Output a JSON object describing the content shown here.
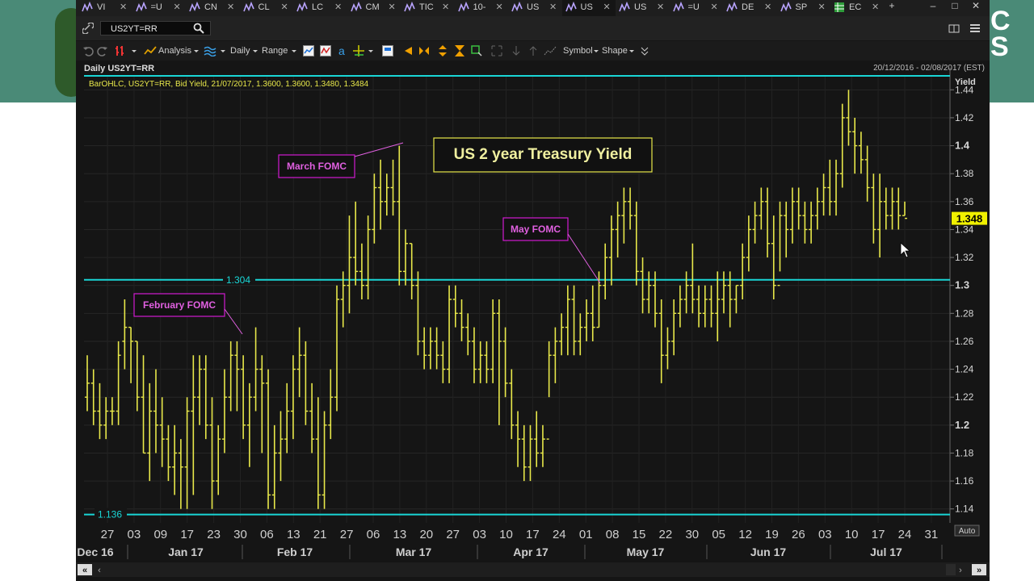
{
  "tabs": [
    {
      "label": "VI",
      "active": false
    },
    {
      "label": "=U",
      "active": false
    },
    {
      "label": "CN",
      "active": false
    },
    {
      "label": "CL",
      "active": false
    },
    {
      "label": "LC",
      "active": false
    },
    {
      "label": "CM",
      "active": false
    },
    {
      "label": "TIC",
      "active": false
    },
    {
      "label": "10-",
      "active": false
    },
    {
      "label": "US",
      "active": false
    },
    {
      "label": "US",
      "active": true
    },
    {
      "label": "US",
      "active": false
    },
    {
      "label": "=U",
      "active": false
    },
    {
      "label": "DE",
      "active": false
    },
    {
      "label": "SP",
      "active": false
    },
    {
      "label": "EC",
      "active": false
    }
  ],
  "window_controls": {
    "add": "+",
    "minimize": "–",
    "maximize": "□",
    "close": "✕"
  },
  "address": {
    "ric": "US2YT=RR"
  },
  "toolbar": {
    "analysis": "Analysis",
    "interval": "Daily",
    "range": "Range",
    "symbol": "Symbol",
    "shape": "Shape"
  },
  "background": {
    "side_text": "C\nS"
  },
  "colors": {
    "bars": "#e8e84a",
    "hline": "#19d6d6",
    "annotation_border": "#d01ad0",
    "annotation_text": "#e060e0",
    "title_border": "#e8e84a",
    "last_badge": "#f0f000"
  },
  "chart_data": {
    "type": "ohlc",
    "header": "Daily US2YT=RR",
    "date_range": "20/12/2016 - 02/08/2017 (EST)",
    "info_line": "BarOHLC, US2YT=RR, Bid Yield, 21/07/2017, 1.3600, 1.3600, 1.3480, 1.3484",
    "title": "US 2 year Treasury Yield",
    "y_axis_label": "Yield",
    "auto_label": "Auto",
    "ylim": [
      1.13,
      1.45
    ],
    "y_ticks": [
      1.14,
      1.16,
      1.18,
      1.2,
      1.22,
      1.24,
      1.26,
      1.28,
      1.3,
      1.32,
      1.34,
      1.36,
      1.38,
      1.4,
      1.42,
      1.44
    ],
    "y_tick_labels": [
      "1.14",
      "1.16",
      "1.18",
      "1.2",
      "1.22",
      "1.24",
      "1.26",
      "1.28",
      "1.3",
      "1.32",
      "1.34",
      "1.36",
      "1.38",
      "1.4",
      "1.42",
      "1.44"
    ],
    "last_value": "1.348",
    "day_labels": [
      "27",
      "03",
      "09",
      "17",
      "23",
      "30",
      "06",
      "13",
      "21",
      "27",
      "06",
      "13",
      "20",
      "27",
      "03",
      "10",
      "17",
      "24",
      "01",
      "08",
      "15",
      "22",
      "30",
      "05",
      "12",
      "19",
      "26",
      "03",
      "10",
      "17",
      "24",
      "31"
    ],
    "month_labels": [
      "Dec 16",
      "Jan 17",
      "Feb 17",
      "Mar 17",
      "Apr 17",
      "May 17",
      "Jun 17",
      "Jul 17"
    ],
    "horizontal_lines": [
      {
        "value": 1.304,
        "label": "1.304"
      },
      {
        "value": 1.136,
        "label": "1.136"
      },
      {
        "value": 1.45,
        "label": ""
      }
    ],
    "annotations": [
      "February FOMC",
      "March FOMC",
      "May FOMC"
    ],
    "bars": [
      [
        1.22,
        1.25,
        1.21,
        1.23
      ],
      [
        1.23,
        1.24,
        1.2,
        1.21
      ],
      [
        1.21,
        1.23,
        1.19,
        1.2
      ],
      [
        1.2,
        1.22,
        1.19,
        1.21
      ],
      [
        1.21,
        1.22,
        1.2,
        1.21
      ],
      [
        1.21,
        1.26,
        1.2,
        1.25
      ],
      [
        1.26,
        1.29,
        1.24,
        1.27
      ],
      [
        1.27,
        1.27,
        1.23,
        1.26
      ],
      [
        1.26,
        1.26,
        1.21,
        1.22
      ],
      [
        1.22,
        1.25,
        1.18,
        1.18
      ],
      [
        1.18,
        1.23,
        1.16,
        1.21
      ],
      [
        1.21,
        1.24,
        1.18,
        1.2
      ],
      [
        1.2,
        1.22,
        1.17,
        1.19
      ],
      [
        1.19,
        1.2,
        1.16,
        1.17
      ],
      [
        1.17,
        1.2,
        1.15,
        1.18
      ],
      [
        1.18,
        1.19,
        1.14,
        1.17
      ],
      [
        1.17,
        1.22,
        1.14,
        1.21
      ],
      [
        1.21,
        1.25,
        1.15,
        1.22
      ],
      [
        1.22,
        1.25,
        1.2,
        1.24
      ],
      [
        1.24,
        1.25,
        1.19,
        1.2
      ],
      [
        1.2,
        1.22,
        1.14,
        1.16
      ],
      [
        1.16,
        1.2,
        1.15,
        1.19
      ],
      [
        1.19,
        1.24,
        1.18,
        1.22
      ],
      [
        1.22,
        1.26,
        1.21,
        1.25
      ],
      [
        1.25,
        1.26,
        1.21,
        1.24
      ],
      [
        1.24,
        1.25,
        1.19,
        1.2
      ],
      [
        1.2,
        1.23,
        1.17,
        1.22
      ],
      [
        1.22,
        1.27,
        1.21,
        1.24
      ],
      [
        1.24,
        1.25,
        1.18,
        1.23
      ],
      [
        1.23,
        1.24,
        1.14,
        1.15
      ],
      [
        1.15,
        1.2,
        1.14,
        1.18
      ],
      [
        1.18,
        1.21,
        1.16,
        1.19
      ],
      [
        1.19,
        1.23,
        1.18,
        1.21
      ],
      [
        1.21,
        1.25,
        1.19,
        1.24
      ],
      [
        1.24,
        1.27,
        1.22,
        1.25
      ],
      [
        1.25,
        1.26,
        1.2,
        1.21
      ],
      [
        1.21,
        1.23,
        1.18,
        1.19
      ],
      [
        1.19,
        1.22,
        1.14,
        1.15
      ],
      [
        1.15,
        1.21,
        1.14,
        1.2
      ],
      [
        1.2,
        1.24,
        1.19,
        1.22
      ],
      [
        1.22,
        1.3,
        1.21,
        1.29
      ],
      [
        1.29,
        1.31,
        1.27,
        1.3
      ],
      [
        1.3,
        1.35,
        1.28,
        1.32
      ],
      [
        1.32,
        1.36,
        1.3,
        1.31
      ],
      [
        1.31,
        1.33,
        1.29,
        1.3
      ],
      [
        1.3,
        1.35,
        1.29,
        1.34
      ],
      [
        1.34,
        1.38,
        1.33,
        1.37
      ],
      [
        1.37,
        1.39,
        1.34,
        1.36
      ],
      [
        1.36,
        1.38,
        1.35,
        1.37
      ],
      [
        1.37,
        1.39,
        1.35,
        1.36
      ],
      [
        1.36,
        1.4,
        1.3,
        1.31
      ],
      [
        1.31,
        1.34,
        1.3,
        1.33
      ],
      [
        1.33,
        1.33,
        1.29,
        1.3
      ],
      [
        1.3,
        1.31,
        1.25,
        1.26
      ],
      [
        1.26,
        1.27,
        1.24,
        1.25
      ],
      [
        1.25,
        1.27,
        1.24,
        1.26
      ],
      [
        1.26,
        1.27,
        1.24,
        1.25
      ],
      [
        1.25,
        1.26,
        1.23,
        1.24
      ],
      [
        1.24,
        1.3,
        1.23,
        1.29
      ],
      [
        1.29,
        1.3,
        1.27,
        1.28
      ],
      [
        1.28,
        1.29,
        1.26,
        1.27
      ],
      [
        1.27,
        1.28,
        1.25,
        1.26
      ],
      [
        1.26,
        1.27,
        1.23,
        1.24
      ],
      [
        1.24,
        1.26,
        1.23,
        1.25
      ],
      [
        1.25,
        1.26,
        1.23,
        1.24
      ],
      [
        1.24,
        1.29,
        1.23,
        1.28
      ],
      [
        1.28,
        1.29,
        1.2,
        1.26
      ],
      [
        1.26,
        1.27,
        1.22,
        1.23
      ],
      [
        1.23,
        1.24,
        1.19,
        1.2
      ],
      [
        1.2,
        1.21,
        1.17,
        1.19
      ],
      [
        1.19,
        1.2,
        1.16,
        1.17
      ],
      [
        1.17,
        1.2,
        1.16,
        1.19
      ],
      [
        1.19,
        1.21,
        1.17,
        1.18
      ],
      [
        1.18,
        1.2,
        1.17,
        1.19
      ],
      [
        1.19,
        1.26,
        1.22,
        1.25
      ],
      [
        1.25,
        1.27,
        1.23,
        1.26
      ],
      [
        1.26,
        1.28,
        1.25,
        1.27
      ],
      [
        1.27,
        1.3,
        1.25,
        1.29
      ],
      [
        1.29,
        1.3,
        1.25,
        1.26
      ],
      [
        1.26,
        1.28,
        1.25,
        1.27
      ],
      [
        1.27,
        1.29,
        1.26,
        1.28
      ],
      [
        1.28,
        1.3,
        1.26,
        1.27
      ],
      [
        1.27,
        1.31,
        1.27,
        1.3
      ],
      [
        1.3,
        1.33,
        1.29,
        1.32
      ],
      [
        1.32,
        1.35,
        1.3,
        1.34
      ],
      [
        1.34,
        1.36,
        1.32,
        1.35
      ],
      [
        1.35,
        1.37,
        1.33,
        1.36
      ],
      [
        1.36,
        1.37,
        1.34,
        1.35
      ],
      [
        1.35,
        1.36,
        1.3,
        1.31
      ],
      [
        1.31,
        1.32,
        1.28,
        1.29
      ],
      [
        1.29,
        1.31,
        1.28,
        1.3
      ],
      [
        1.3,
        1.31,
        1.27,
        1.28
      ],
      [
        1.28,
        1.29,
        1.23,
        1.25
      ],
      [
        1.25,
        1.27,
        1.24,
        1.26
      ],
      [
        1.26,
        1.29,
        1.25,
        1.28
      ],
      [
        1.28,
        1.3,
        1.27,
        1.29
      ],
      [
        1.29,
        1.31,
        1.28,
        1.3
      ],
      [
        1.3,
        1.33,
        1.28,
        1.29
      ],
      [
        1.29,
        1.3,
        1.27,
        1.28
      ],
      [
        1.28,
        1.3,
        1.27,
        1.29
      ],
      [
        1.29,
        1.3,
        1.27,
        1.28
      ],
      [
        1.28,
        1.31,
        1.26,
        1.29
      ],
      [
        1.29,
        1.31,
        1.28,
        1.3
      ],
      [
        1.3,
        1.31,
        1.27,
        1.29
      ],
      [
        1.29,
        1.3,
        1.28,
        1.3
      ],
      [
        1.3,
        1.33,
        1.29,
        1.32
      ],
      [
        1.32,
        1.35,
        1.31,
        1.34
      ],
      [
        1.34,
        1.36,
        1.33,
        1.35
      ],
      [
        1.35,
        1.37,
        1.34,
        1.36
      ],
      [
        1.36,
        1.37,
        1.32,
        1.33
      ],
      [
        1.33,
        1.35,
        1.29,
        1.3
      ],
      [
        1.3,
        1.36,
        1.31,
        1.35
      ],
      [
        1.35,
        1.36,
        1.32,
        1.34
      ],
      [
        1.34,
        1.37,
        1.33,
        1.36
      ],
      [
        1.36,
        1.37,
        1.34,
        1.35
      ],
      [
        1.35,
        1.36,
        1.33,
        1.34
      ],
      [
        1.34,
        1.36,
        1.33,
        1.35
      ],
      [
        1.35,
        1.37,
        1.34,
        1.36
      ],
      [
        1.36,
        1.38,
        1.35,
        1.37
      ],
      [
        1.37,
        1.39,
        1.35,
        1.36
      ],
      [
        1.36,
        1.39,
        1.35,
        1.38
      ],
      [
        1.38,
        1.43,
        1.37,
        1.42
      ],
      [
        1.42,
        1.44,
        1.4,
        1.41
      ],
      [
        1.41,
        1.42,
        1.38,
        1.4
      ],
      [
        1.4,
        1.41,
        1.38,
        1.39
      ],
      [
        1.39,
        1.4,
        1.36,
        1.37
      ],
      [
        1.37,
        1.38,
        1.33,
        1.34
      ],
      [
        1.34,
        1.38,
        1.32,
        1.36
      ],
      [
        1.36,
        1.37,
        1.34,
        1.35
      ],
      [
        1.35,
        1.37,
        1.34,
        1.36
      ],
      [
        1.36,
        1.37,
        1.34,
        1.35
      ],
      [
        1.35,
        1.36,
        1.35,
        1.348
      ]
    ]
  }
}
